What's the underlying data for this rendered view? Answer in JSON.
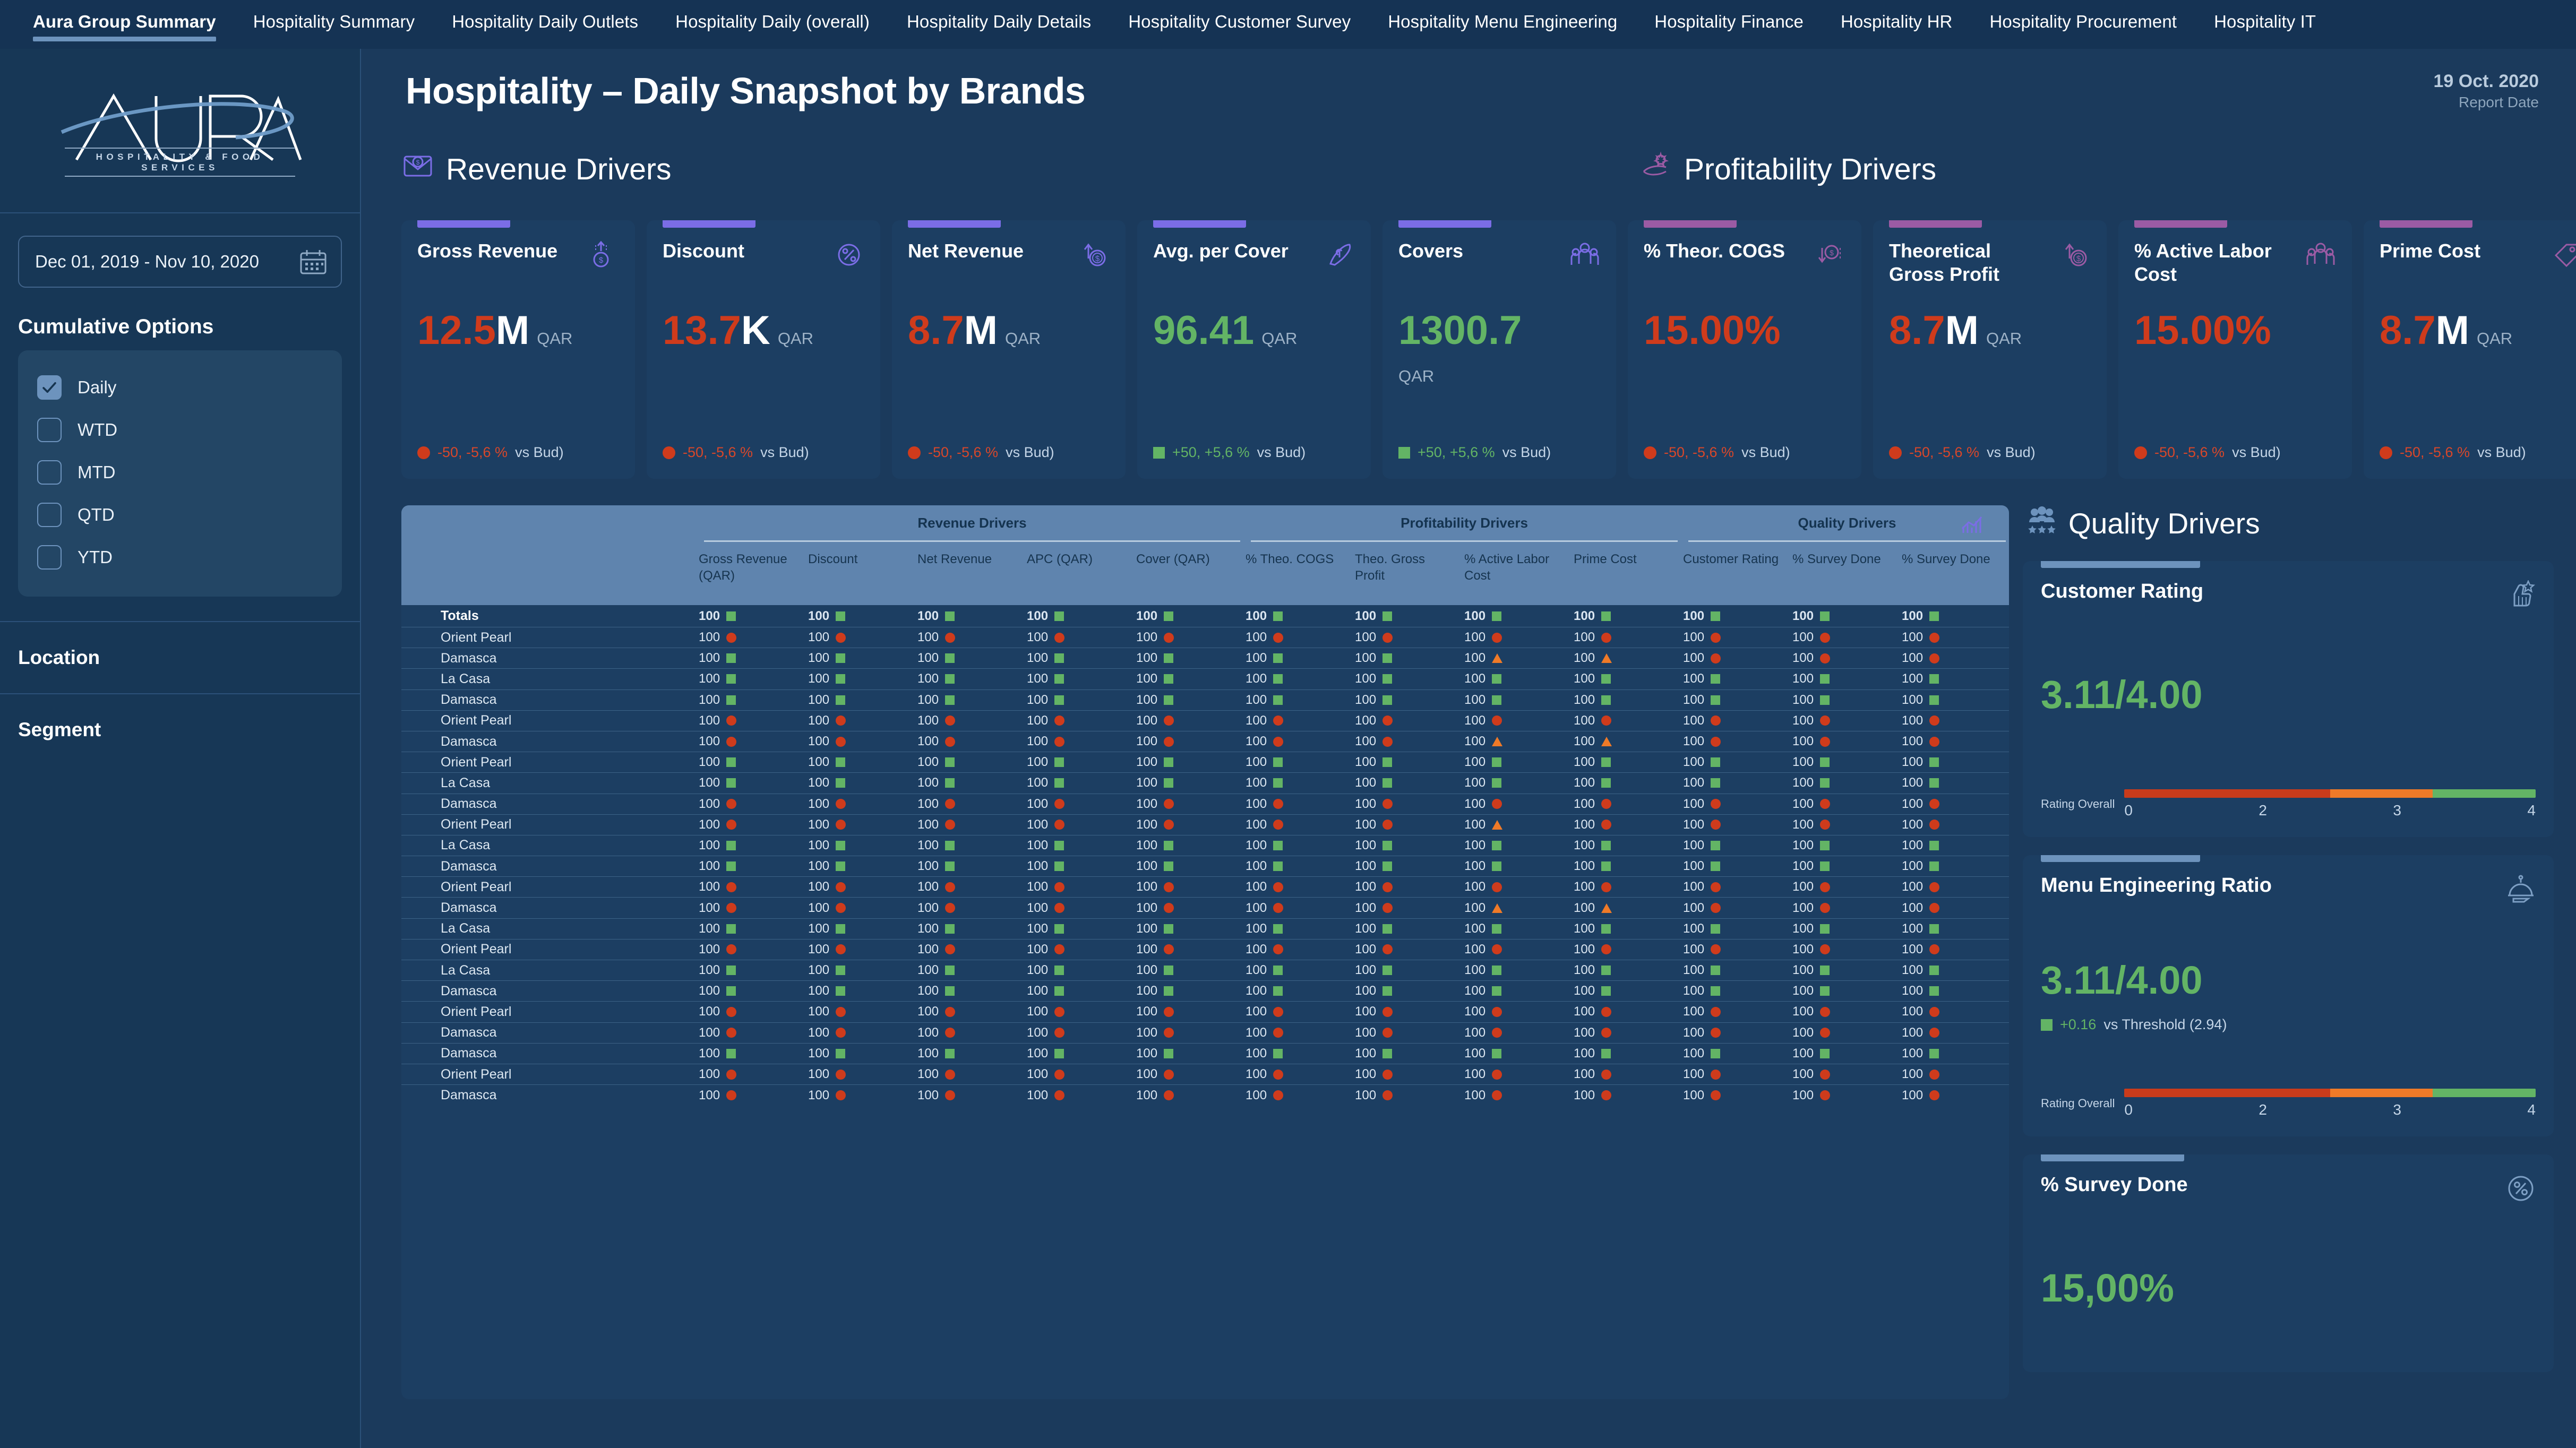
{
  "nav": {
    "items": [
      {
        "label": "Aura Group Summary",
        "active": true
      },
      {
        "label": "Hospitality Summary",
        "active": false
      },
      {
        "label": "Hospitality Daily Outlets",
        "active": false
      },
      {
        "label": "Hospitality Daily (overall)",
        "active": false
      },
      {
        "label": "Hospitality Daily Details",
        "active": false
      },
      {
        "label": "Hospitality Customer Survey",
        "active": false
      },
      {
        "label": "Hospitality Menu Engineering",
        "active": false
      },
      {
        "label": "Hospitality Finance",
        "active": false
      },
      {
        "label": "Hospitality HR",
        "active": false
      },
      {
        "label": "Hospitality Procurement",
        "active": false
      },
      {
        "label": "Hospitality IT",
        "active": false
      }
    ]
  },
  "sidebar": {
    "logo": {
      "name": "AURA",
      "tagline": "HOSPITALITY & FOOD SERVICES"
    },
    "date_range": "Dec 01, 2019 - Nov 10, 2020",
    "cumulative": {
      "title": "Cumulative Options",
      "options": [
        {
          "label": "Daily",
          "checked": true
        },
        {
          "label": "WTD",
          "checked": false
        },
        {
          "label": "MTD",
          "checked": false
        },
        {
          "label": "QTD",
          "checked": false
        },
        {
          "label": "YTD",
          "checked": false
        }
      ]
    },
    "filters": [
      {
        "label": "Location"
      },
      {
        "label": "Segment"
      }
    ]
  },
  "header": {
    "title": "Hospitality – Daily Snapshot by Brands",
    "report_date_value": "19 Oct. 2020",
    "report_date_label": "Report Date"
  },
  "bands": {
    "revenue": {
      "title": "Revenue Drivers",
      "icon": "revenue-envelope-icon",
      "accent": "#7b6de6"
    },
    "profitability": {
      "title": "Profitability Drivers",
      "icon": "hand-coin-icon",
      "accent": "#9b5ba4"
    }
  },
  "kpis": [
    {
      "group": "rev",
      "title": "Gross Revenue",
      "value": "12.5",
      "unit": "M",
      "value_color": "red",
      "currency": "QAR",
      "currency_below": false,
      "icon": "coin-up-icon",
      "delta": "-50, -5,6 %",
      "delta_suffix": " vs Bud)",
      "status": "negative"
    },
    {
      "group": "rev",
      "title": "Discount",
      "value": "13.7",
      "unit": "K",
      "value_color": "red",
      "currency": "QAR",
      "currency_below": false,
      "icon": "percent-badge-icon",
      "delta": "-50, -5,6 %",
      "delta_suffix": " vs Bud)",
      "status": "negative"
    },
    {
      "group": "rev",
      "title": "Net Revenue",
      "value": "8.7",
      "unit": "M",
      "value_color": "red",
      "currency": "QAR",
      "currency_below": false,
      "icon": "coin-arrow-icon",
      "delta": "-50, -5,6 %",
      "delta_suffix": " vs Bud)",
      "status": "negative"
    },
    {
      "group": "rev",
      "title": "Avg. per Cover",
      "value": "96.41",
      "unit": "",
      "value_color": "green",
      "currency": "QAR",
      "currency_below": false,
      "icon": "hand-money-icon",
      "delta": "+50, +5,6 %",
      "delta_suffix": " vs Bud)",
      "status": "positive"
    },
    {
      "group": "rev",
      "title": "Covers",
      "value": "1300.7",
      "unit": "",
      "value_color": "green",
      "currency": "QAR",
      "currency_below": true,
      "icon": "people-icon",
      "delta": "+50, +5,6 %",
      "delta_suffix": " vs Bud)",
      "status": "positive"
    },
    {
      "group": "prof",
      "title": "% Theor. COGS",
      "value": "15.00%",
      "unit": "",
      "value_color": "red",
      "currency": "",
      "currency_below": false,
      "icon": "cost-down-icon",
      "delta": "-50, -5,6 %",
      "delta_suffix": " vs Bud)",
      "status": "negative"
    },
    {
      "group": "prof",
      "title": "Theoretical Gross Profit",
      "value": "8.7",
      "unit": "M",
      "value_color": "red",
      "currency": "QAR",
      "currency_below": false,
      "icon": "coin-arrow-icon",
      "delta": "-50, -5,6 %",
      "delta_suffix": " vs Bud)",
      "status": "negative"
    },
    {
      "group": "prof",
      "title": "% Active Labor Cost",
      "value": "15.00%",
      "unit": "",
      "value_color": "red",
      "currency": "",
      "currency_below": false,
      "icon": "people-icon",
      "delta": "-50, -5,6 %",
      "delta_suffix": " vs Bud)",
      "status": "negative"
    },
    {
      "group": "prof",
      "title": "Prime Cost",
      "value": "8.7",
      "unit": "M",
      "value_color": "red",
      "currency": "QAR",
      "currency_below": false,
      "icon": "tag-cost-icon",
      "delta": "-50, -5,6 %",
      "delta_suffix": " vs Bud)",
      "status": "negative"
    }
  ],
  "table": {
    "groups": [
      {
        "label": "Revenue Drivers",
        "span": 5
      },
      {
        "label": "Profitability Drivers",
        "span": 4
      },
      {
        "label": "Quality Drivers",
        "span": 3
      }
    ],
    "columns": [
      "Gross Revenue (QAR)",
      "Discount",
      "Net Revenue",
      "APC (QAR)",
      "Cover (QAR)",
      "% Theo. COGS",
      "Theo. Gross Profit",
      "% Active Labor Cost",
      "Prime Cost",
      "Customer Rating",
      "% Survey Done",
      "% Survey Done"
    ],
    "cell_value": "100",
    "rows": [
      {
        "name": "Totals",
        "totals": true,
        "status": [
          "s",
          "s",
          "s",
          "s",
          "s",
          "s",
          "s",
          "s",
          "s",
          "s",
          "s",
          "s"
        ]
      },
      {
        "name": "Orient Pearl",
        "totals": false,
        "status": [
          "c",
          "c",
          "c",
          "c",
          "c",
          "c",
          "c",
          "c",
          "c",
          "c",
          "c",
          "c"
        ]
      },
      {
        "name": "Damasca",
        "totals": false,
        "status": [
          "s",
          "s",
          "s",
          "s",
          "s",
          "s",
          "s",
          "t",
          "t",
          "c",
          "c",
          "c"
        ]
      },
      {
        "name": "La Casa",
        "totals": false,
        "status": [
          "s",
          "s",
          "s",
          "s",
          "s",
          "s",
          "s",
          "s",
          "s",
          "s",
          "s",
          "s"
        ]
      },
      {
        "name": "Damasca",
        "totals": false,
        "status": [
          "s",
          "s",
          "s",
          "s",
          "s",
          "s",
          "s",
          "s",
          "s",
          "s",
          "s",
          "s"
        ]
      },
      {
        "name": "Orient Pearl",
        "totals": false,
        "status": [
          "c",
          "c",
          "c",
          "c",
          "c",
          "c",
          "c",
          "c",
          "c",
          "c",
          "c",
          "c"
        ]
      },
      {
        "name": "Damasca",
        "totals": false,
        "status": [
          "c",
          "c",
          "c",
          "c",
          "c",
          "c",
          "c",
          "t",
          "t",
          "c",
          "c",
          "c"
        ]
      },
      {
        "name": "Orient Pearl",
        "totals": false,
        "status": [
          "s",
          "s",
          "s",
          "s",
          "s",
          "s",
          "s",
          "s",
          "s",
          "s",
          "s",
          "s"
        ]
      },
      {
        "name": "La Casa",
        "totals": false,
        "status": [
          "s",
          "s",
          "s",
          "s",
          "s",
          "s",
          "s",
          "s",
          "s",
          "s",
          "s",
          "s"
        ]
      },
      {
        "name": "Damasca",
        "totals": false,
        "status": [
          "c",
          "c",
          "c",
          "c",
          "c",
          "c",
          "c",
          "c",
          "c",
          "c",
          "c",
          "c"
        ]
      },
      {
        "name": "Orient Pearl",
        "totals": false,
        "status": [
          "c",
          "c",
          "c",
          "c",
          "c",
          "c",
          "c",
          "t",
          "c",
          "c",
          "c",
          "c"
        ]
      },
      {
        "name": "La Casa",
        "totals": false,
        "status": [
          "s",
          "s",
          "s",
          "s",
          "s",
          "s",
          "s",
          "s",
          "s",
          "s",
          "s",
          "s"
        ]
      },
      {
        "name": "Damasca",
        "totals": false,
        "status": [
          "s",
          "s",
          "s",
          "s",
          "s",
          "s",
          "s",
          "s",
          "s",
          "s",
          "s",
          "s"
        ]
      },
      {
        "name": "Orient Pearl",
        "totals": false,
        "status": [
          "c",
          "c",
          "c",
          "c",
          "c",
          "c",
          "c",
          "c",
          "c",
          "c",
          "c",
          "c"
        ]
      },
      {
        "name": "Damasca",
        "totals": false,
        "status": [
          "c",
          "c",
          "c",
          "c",
          "c",
          "c",
          "c",
          "t",
          "t",
          "c",
          "c",
          "c"
        ]
      },
      {
        "name": "La Casa",
        "totals": false,
        "status": [
          "s",
          "s",
          "s",
          "s",
          "s",
          "s",
          "s",
          "s",
          "s",
          "s",
          "s",
          "s"
        ]
      },
      {
        "name": "Orient Pearl",
        "totals": false,
        "status": [
          "c",
          "c",
          "c",
          "c",
          "c",
          "c",
          "c",
          "c",
          "c",
          "c",
          "c",
          "c"
        ]
      },
      {
        "name": "La Casa",
        "totals": false,
        "status": [
          "s",
          "s",
          "s",
          "s",
          "s",
          "s",
          "s",
          "s",
          "s",
          "s",
          "s",
          "s"
        ]
      },
      {
        "name": "Damasca",
        "totals": false,
        "status": [
          "s",
          "s",
          "s",
          "s",
          "s",
          "s",
          "s",
          "s",
          "s",
          "s",
          "s",
          "s"
        ]
      },
      {
        "name": "Orient Pearl",
        "totals": false,
        "status": [
          "c",
          "c",
          "c",
          "c",
          "c",
          "c",
          "c",
          "c",
          "c",
          "c",
          "c",
          "c"
        ]
      },
      {
        "name": "Damasca",
        "totals": false,
        "status": [
          "c",
          "c",
          "c",
          "c",
          "c",
          "c",
          "c",
          "c",
          "c",
          "c",
          "c",
          "c"
        ]
      },
      {
        "name": "Damasca",
        "totals": false,
        "status": [
          "s",
          "s",
          "s",
          "s",
          "s",
          "s",
          "s",
          "s",
          "s",
          "s",
          "s",
          "s"
        ]
      },
      {
        "name": "Orient Pearl",
        "totals": false,
        "status": [
          "c",
          "c",
          "c",
          "c",
          "c",
          "c",
          "c",
          "c",
          "c",
          "c",
          "c",
          "c"
        ]
      },
      {
        "name": "Damasca",
        "totals": false,
        "status": [
          "c",
          "c",
          "c",
          "c",
          "c",
          "c",
          "c",
          "c",
          "c",
          "c",
          "c",
          "c"
        ]
      }
    ]
  },
  "quality": {
    "title": "Quality Drivers",
    "cards": [
      {
        "title": "Customer Rating",
        "value": "3.11/4.00",
        "icon": "thumbs-up-star-icon",
        "delta": "",
        "delta_text": "",
        "has_delta": false,
        "scale_label": "Rating Overall",
        "ticks": [
          "0",
          "2",
          "3",
          "4"
        ]
      },
      {
        "title": "Menu Engineering Ratio",
        "value": "3.11/4.00",
        "icon": "cloche-icon",
        "delta": "+0.16",
        "delta_text": " vs Threshold (2.94)",
        "has_delta": true,
        "scale_label": "Rating Overall",
        "ticks": [
          "0",
          "2",
          "3",
          "4"
        ]
      },
      {
        "title": "% Survey Done",
        "value": "15,00%",
        "icon": "percent-circle-icon",
        "delta": "",
        "delta_text": "",
        "has_delta": false,
        "scale_label": "",
        "ticks": []
      }
    ]
  },
  "colors": {
    "bg": "#1b3a5c",
    "panel": "#1c3e62",
    "nav_bg": "#153354",
    "accent_revenue": "#7b6de6",
    "accent_profit": "#9b5ba4",
    "accent_quality": "#6d93bd",
    "negative": "#cf3b1c",
    "positive": "#63b465",
    "warning": "#ef7a28",
    "table_header": "#5f84ae"
  }
}
